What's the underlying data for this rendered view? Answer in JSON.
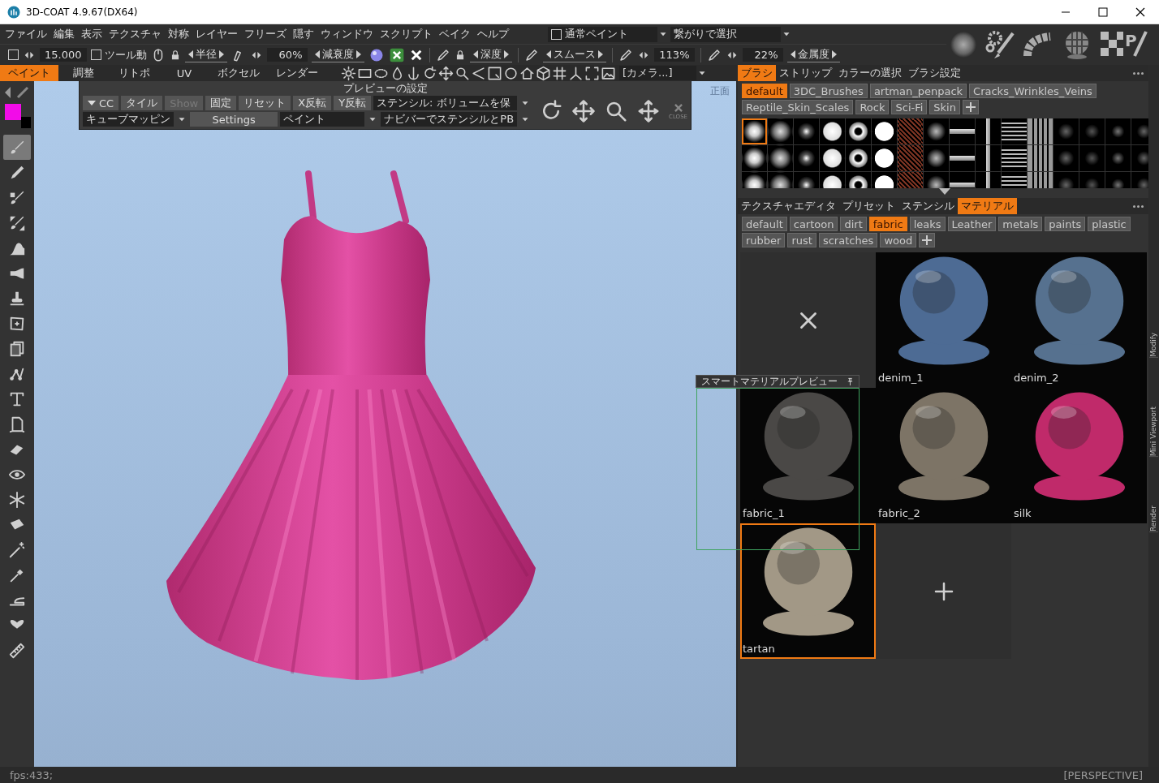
{
  "window": {
    "title": "3D-COAT 4.9.67(DX64)"
  },
  "menu": [
    "ファイル",
    "編集",
    "表示",
    "テクスチャ",
    "対称",
    "レイヤー",
    "フリーズ",
    "隠す",
    "ウィンドウ",
    "スクリプト",
    "ベイク",
    "ヘルプ"
  ],
  "paint_mode": {
    "label": "通常ペイント",
    "checked": false
  },
  "select_mode": {
    "value": "繋がりで選択"
  },
  "texture_tool": {
    "letter": "P"
  },
  "toolbar": [
    {
      "kind": "checkbox",
      "checked": false
    },
    {
      "kind": "stepper"
    },
    {
      "kind": "value",
      "text": "15.000"
    },
    {
      "kind": "checkbox",
      "label": "ツール動",
      "checked": false
    },
    {
      "kind": "mouse"
    },
    {
      "kind": "lock"
    },
    {
      "kind": "spin",
      "label": "半径"
    },
    {
      "kind": "nib"
    },
    {
      "kind": "stepper"
    },
    {
      "kind": "value",
      "text": "60%"
    },
    {
      "kind": "spin",
      "label": "減衰度"
    },
    {
      "kind": "sphere"
    },
    {
      "kind": "accept"
    },
    {
      "kind": "reject"
    },
    {
      "kind": "pencil"
    },
    {
      "kind": "lock"
    },
    {
      "kind": "spin",
      "label": "深度"
    },
    {
      "kind": "pencil"
    },
    {
      "kind": "spin",
      "label": "スムース"
    },
    {
      "kind": "pencil"
    },
    {
      "kind": "stepper"
    },
    {
      "kind": "value",
      "text": "113%"
    },
    {
      "kind": "pencil"
    },
    {
      "kind": "stepper"
    },
    {
      "kind": "value",
      "text": "22%"
    },
    {
      "kind": "spin",
      "label": "金属度"
    }
  ],
  "mode_tabs": [
    {
      "label": "ペイント",
      "selected": true
    },
    {
      "label": "調整",
      "selected": false
    },
    {
      "label": "リトポ",
      "selected": false
    },
    {
      "label": "UV",
      "selected": false
    },
    {
      "label": "ボクセル",
      "selected": false
    },
    {
      "label": "レンダー",
      "selected": false
    }
  ],
  "camera": {
    "value": "[カメラ...]"
  },
  "right_tabs": [
    {
      "label": "ブラシ",
      "selected": true
    },
    {
      "label": "ストリップ",
      "selected": false
    },
    {
      "label": "カラーの選択",
      "selected": false
    },
    {
      "label": "ブラシ設定",
      "selected": false
    }
  ],
  "brush_packs": [
    {
      "label": "default",
      "selected": true
    },
    {
      "label": "3DC_Brushes",
      "selected": false
    },
    {
      "label": "artman_penpack",
      "selected": false
    },
    {
      "label": "Cracks_Wrinkles_Veins",
      "selected": false
    },
    {
      "label": "Reptile_Skin_Scales",
      "selected": false
    },
    {
      "label": "Rock",
      "selected": false
    },
    {
      "label": "Sci-Fi",
      "selected": false
    },
    {
      "label": "Skin",
      "selected": false
    }
  ],
  "brushes": [
    {
      "selected": true
    },
    {
      "selected": false
    },
    {
      "selected": false
    },
    {
      "selected": false
    },
    {
      "selected": false
    },
    {
      "selected": false
    },
    {
      "selected": false
    },
    {
      "selected": false
    },
    {
      "selected": false
    },
    {
      "selected": false
    },
    {
      "selected": false
    },
    {
      "selected": false
    },
    {
      "selected": false
    },
    {
      "selected": false
    },
    {
      "selected": false
    },
    {
      "selected": false
    },
    {
      "selected": false
    },
    {
      "selected": false
    },
    {
      "selected": false
    },
    {
      "selected": false
    },
    {
      "selected": false
    },
    {
      "selected": false
    },
    {
      "selected": false
    },
    {
      "selected": false
    },
    {
      "selected": false
    },
    {
      "selected": false
    },
    {
      "selected": false
    },
    {
      "selected": false
    },
    {
      "selected": false
    },
    {
      "selected": false
    },
    {
      "selected": false
    },
    {
      "selected": false
    },
    {
      "selected": false
    },
    {
      "selected": false
    },
    {
      "selected": false
    },
    {
      "selected": false
    },
    {
      "selected": false
    },
    {
      "selected": false
    },
    {
      "selected": false
    },
    {
      "selected": false
    },
    {
      "selected": false
    },
    {
      "selected": false
    },
    {
      "selected": false
    },
    {
      "selected": false
    },
    {
      "selected": false
    },
    {
      "selected": false
    },
    {
      "selected": false
    },
    {
      "selected": false
    }
  ],
  "panel_tabs": [
    {
      "label": "テクスチャエディタ",
      "selected": false
    },
    {
      "label": "プリセット",
      "selected": false
    },
    {
      "label": "ステンシル",
      "selected": false
    },
    {
      "label": "マテリアル",
      "selected": true
    }
  ],
  "material_categories": [
    {
      "label": "default",
      "selected": false
    },
    {
      "label": "cartoon",
      "selected": false
    },
    {
      "label": "dirt",
      "selected": false
    },
    {
      "label": "fabric",
      "selected": true
    },
    {
      "label": "leaks",
      "selected": false
    },
    {
      "label": "Leather",
      "selected": false
    },
    {
      "label": "metals",
      "selected": false
    },
    {
      "label": "paints",
      "selected": false
    },
    {
      "label": "plastic",
      "selected": false
    },
    {
      "label": "rubber",
      "selected": false
    },
    {
      "label": "rust",
      "selected": false
    },
    {
      "label": "scratches",
      "selected": false
    },
    {
      "label": "wood",
      "selected": false
    }
  ],
  "materials": [
    {
      "kind": "empty"
    },
    {
      "kind": "material",
      "name": "denim_1",
      "color": "#4d6b94",
      "selected": false
    },
    {
      "kind": "material",
      "name": "denim_2",
      "color": "#56718f",
      "selected": false
    },
    {
      "kind": "material",
      "name": "fabric_1",
      "color": "#4a4846",
      "selected": false
    },
    {
      "kind": "material",
      "name": "fabric_2",
      "color": "#7d7466",
      "selected": false
    },
    {
      "kind": "material",
      "name": "silk",
      "color": "#c02a6a",
      "selected": false
    },
    {
      "kind": "material",
      "name": "tartan",
      "color": "#a29886",
      "selected": true
    },
    {
      "kind": "add"
    }
  ],
  "preview_settings": {
    "title": "プレビューの設定",
    "close_label": "CLOSE",
    "top_controls": [
      {
        "kind": "toggle",
        "label": "CC",
        "disabled": false
      },
      {
        "kind": "button",
        "label": "タイル",
        "disabled": false
      },
      {
        "kind": "button",
        "label": "Show",
        "disabled": true
      },
      {
        "kind": "button",
        "label": "固定",
        "disabled": false
      },
      {
        "kind": "button",
        "label": "リセット",
        "disabled": false
      },
      {
        "kind": "button",
        "label": "X反転",
        "disabled": false
      },
      {
        "kind": "button",
        "label": "Y反転",
        "disabled": false
      },
      {
        "kind": "dropdown",
        "value": "ステンシル: ボリュームを保"
      }
    ],
    "bottom_controls": [
      {
        "kind": "dropdown",
        "value": "キューブマッピン"
      },
      {
        "kind": "button",
        "label": "Settings",
        "disabled": false
      },
      {
        "kind": "dropdown",
        "value": "ペイント"
      },
      {
        "kind": "dropdown",
        "value": "ナビバーでステンシルとPB"
      }
    ]
  },
  "smart_preview": {
    "title": "スマートマテリアルプレビュー"
  },
  "viewport": {
    "view_label": "正面"
  },
  "color_swatches": [
    {
      "color": "#f20ce8"
    },
    {
      "color": "#000000"
    }
  ],
  "tools": [
    {
      "selected": true
    },
    {
      "selected": false
    },
    {
      "selected": false
    },
    {
      "selected": false
    },
    {
      "selected": false
    },
    {
      "selected": false
    },
    {
      "selected": false
    },
    {
      "selected": false
    },
    {
      "selected": false
    },
    {
      "selected": false
    },
    {
      "selected": false
    },
    {
      "selected": false
    },
    {
      "selected": false
    },
    {
      "selected": false
    },
    {
      "selected": false
    },
    {
      "selected": false
    },
    {
      "selected": false
    },
    {
      "selected": false
    },
    {
      "selected": false
    },
    {
      "selected": false
    },
    {
      "selected": false
    }
  ],
  "side_tabs": [
    "Modify",
    "Mini Viewport",
    "Render"
  ],
  "status_bar": {
    "fps": "fps:433;",
    "view": "[PERSPECTIVE]"
  }
}
